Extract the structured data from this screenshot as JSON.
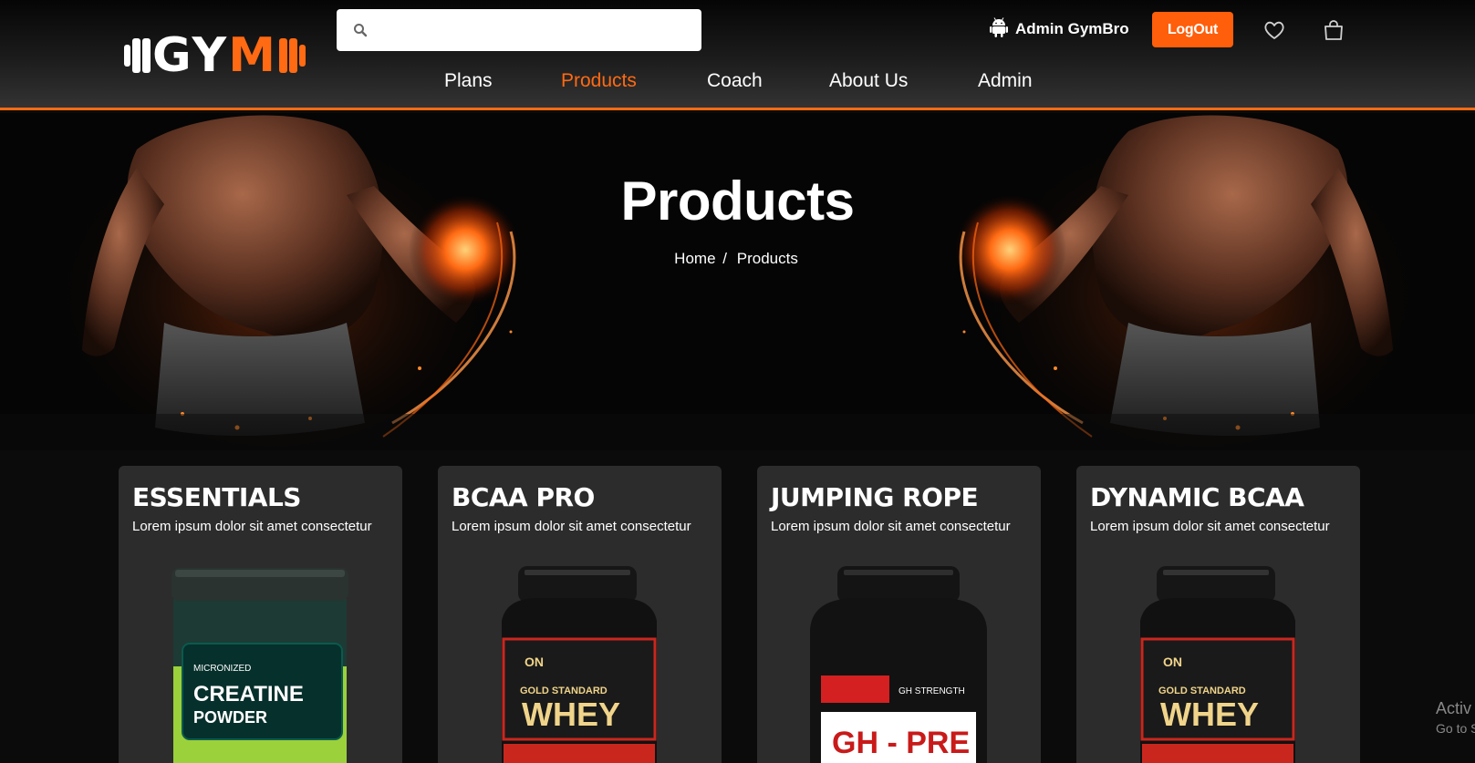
{
  "header": {
    "logo": {
      "text_white": "GY",
      "text_orange": "M"
    },
    "search": {
      "value": "",
      "placeholder": ""
    },
    "user": {
      "name": "Admin GymBro",
      "icon": "android-icon"
    },
    "logout_label": "LogOut",
    "wishlist_icon": "heart-icon",
    "cart_icon": "shopping-bag-icon"
  },
  "nav": {
    "items": [
      {
        "label": "Plans",
        "active": false
      },
      {
        "label": "Products",
        "active": true
      },
      {
        "label": "Coach",
        "active": false
      },
      {
        "label": "About Us",
        "active": false
      },
      {
        "label": "Admin",
        "active": false
      }
    ]
  },
  "hero": {
    "title": "Products",
    "breadcrumb": {
      "home": "Home",
      "separator": "/",
      "current": "Products"
    }
  },
  "products": [
    {
      "title": "ESSENTIALS",
      "description": "Lorem ipsum dolor sit amet consectetur",
      "image": "creatine-powder-jar"
    },
    {
      "title": "BCAA PRO",
      "description": "Lorem ipsum dolor sit amet consectetur",
      "image": "whey-protein-tub"
    },
    {
      "title": "JUMPING ROPE",
      "description": "Lorem ipsum dolor sit amet consectetur",
      "image": "pre-workout-tub"
    },
    {
      "title": "DYNAMIC BCAA",
      "description": "Lorem ipsum dolor sit amet consectetur",
      "image": "whey-protein-tub"
    }
  ],
  "watermark": {
    "line1": "Activ",
    "line2": "Go to S"
  },
  "colors": {
    "accent": "#ff6a13",
    "card": "#2c2c2c",
    "background": "#0b0b0b"
  }
}
